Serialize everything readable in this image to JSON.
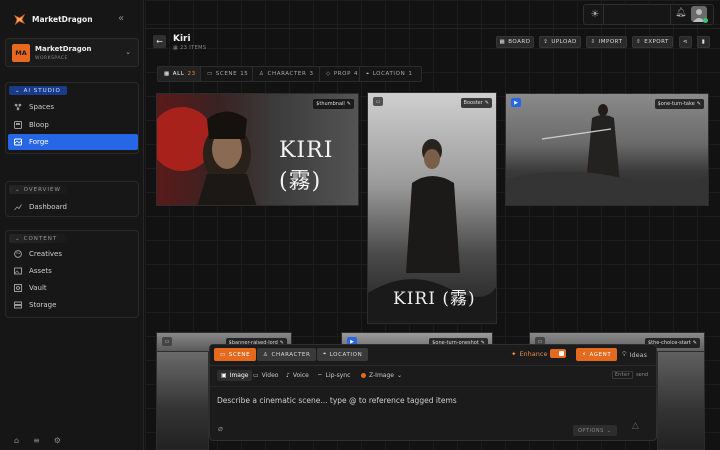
{
  "brand": {
    "name": "MarketDragon"
  },
  "workspace": {
    "initials": "MA",
    "name": "MarketDragon",
    "subtitle": "WORKSPACE"
  },
  "sidebar": {
    "ai_studio": {
      "label": "AI STUDIO",
      "items": [
        {
          "label": "Spaces",
          "icon": "spaces-icon"
        },
        {
          "label": "Bloop",
          "icon": "bloop-icon"
        },
        {
          "label": "Forge",
          "icon": "forge-icon",
          "active": true
        }
      ]
    },
    "overview": {
      "label": "OVERVIEW",
      "items": [
        {
          "label": "Dashboard",
          "icon": "chart-icon"
        }
      ]
    },
    "content": {
      "label": "CONTENT",
      "items": [
        {
          "label": "Creatives",
          "icon": "palette-icon"
        },
        {
          "label": "Assets",
          "icon": "image-icon"
        },
        {
          "label": "Vault",
          "icon": "vault-icon"
        },
        {
          "label": "Storage",
          "icon": "storage-icon"
        }
      ]
    }
  },
  "page": {
    "title": "Kiri",
    "count": "23 ITEMS"
  },
  "actions": {
    "board": "BOARD",
    "upload": "UPLOAD",
    "import": "IMPORT",
    "export": "EXPORT"
  },
  "filters": [
    {
      "label": "ALL",
      "count": "23"
    },
    {
      "label": "SCENE",
      "count": "15"
    },
    {
      "label": "CHARACTER",
      "count": "3"
    },
    {
      "label": "PROP",
      "count": "4"
    },
    {
      "label": "LOCATION",
      "count": "1"
    }
  ],
  "cards": [
    {
      "tag": "$thumbnail",
      "title_text": "KIRI (霧)"
    },
    {
      "tag": "Booster",
      "title_text": "KIRI (霧)"
    },
    {
      "tag": "$one-turn-take"
    },
    {
      "tag": "$banner-raised-lord"
    },
    {
      "tag": "$one-turn-oneshot"
    },
    {
      "tag": "$the-choice-start"
    }
  ],
  "prompt": {
    "scene": "SCENE",
    "character": "CHARACTER",
    "location": "LOCATION",
    "enhance": "Enhance",
    "agent": "AGENT",
    "ideas": "Ideas",
    "modes": [
      "Image",
      "Video",
      "Voice",
      "Lip-sync"
    ],
    "model": "Z-Image",
    "enter_key": "Enter",
    "enter_label": "send",
    "placeholder": "Describe a cinematic scene... type @ to reference tagged items",
    "options": "OPTIONS"
  },
  "colors": {
    "accent_orange": "#e56a1e",
    "accent_blue": "#2767e6"
  }
}
